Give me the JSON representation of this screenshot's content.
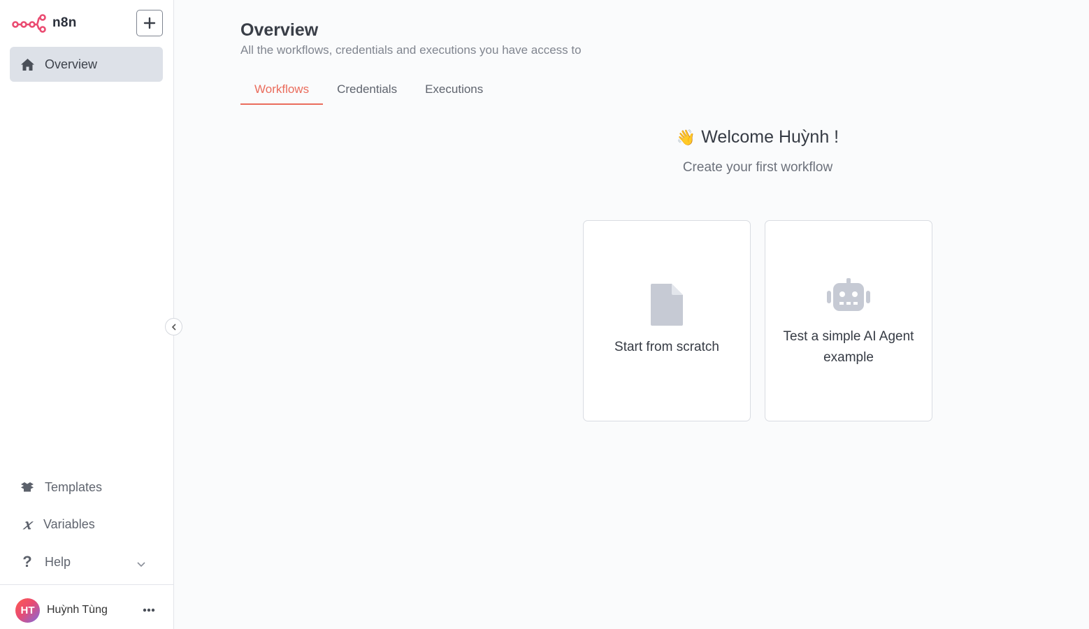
{
  "app": {
    "name": "n8n"
  },
  "sidebar": {
    "add_button_icon": "plus-icon",
    "nav": [
      {
        "label": "Overview",
        "icon": "home-icon",
        "active": true
      }
    ],
    "bottom": [
      {
        "label": "Templates",
        "icon": "templates-box-icon"
      },
      {
        "label": "Variables",
        "icon": "variable-x-icon"
      },
      {
        "label": "Help",
        "icon": "question-icon"
      }
    ],
    "user": {
      "initials": "HT",
      "name": "Huỳnh Tùng"
    }
  },
  "main": {
    "title": "Overview",
    "subtitle": "All the workflows, credentials and executions you have access to",
    "tabs": [
      {
        "label": "Workflows",
        "active": true
      },
      {
        "label": "Credentials",
        "active": false
      },
      {
        "label": "Executions",
        "active": false
      }
    ],
    "welcome": {
      "emoji": "👋",
      "heading": "Welcome Huỳnh !",
      "subheading": "Create your first workflow"
    },
    "cards": [
      {
        "label": "Start from scratch",
        "icon": "file-icon"
      },
      {
        "label": "Test a simple AI Agent example",
        "icon": "robot-icon"
      }
    ]
  },
  "colors": {
    "accent": "#ea6c5c",
    "brand": "#ea4b71",
    "sidebar_active_bg": "#dde1e8",
    "icon_muted": "#c6cad4"
  }
}
